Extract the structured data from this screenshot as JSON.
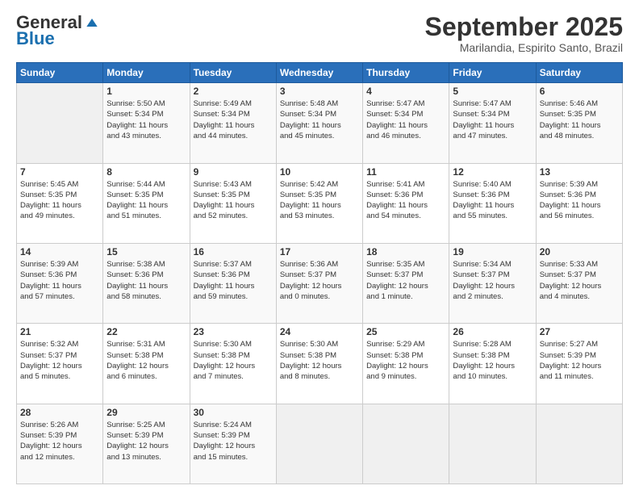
{
  "header": {
    "logo_general": "General",
    "logo_blue": "Blue",
    "month_title": "September 2025",
    "location": "Marilandia, Espirito Santo, Brazil"
  },
  "weekdays": [
    "Sunday",
    "Monday",
    "Tuesday",
    "Wednesday",
    "Thursday",
    "Friday",
    "Saturday"
  ],
  "weeks": [
    [
      {
        "day": "",
        "info": ""
      },
      {
        "day": "1",
        "info": "Sunrise: 5:50 AM\nSunset: 5:34 PM\nDaylight: 11 hours\nand 43 minutes."
      },
      {
        "day": "2",
        "info": "Sunrise: 5:49 AM\nSunset: 5:34 PM\nDaylight: 11 hours\nand 44 minutes."
      },
      {
        "day": "3",
        "info": "Sunrise: 5:48 AM\nSunset: 5:34 PM\nDaylight: 11 hours\nand 45 minutes."
      },
      {
        "day": "4",
        "info": "Sunrise: 5:47 AM\nSunset: 5:34 PM\nDaylight: 11 hours\nand 46 minutes."
      },
      {
        "day": "5",
        "info": "Sunrise: 5:47 AM\nSunset: 5:34 PM\nDaylight: 11 hours\nand 47 minutes."
      },
      {
        "day": "6",
        "info": "Sunrise: 5:46 AM\nSunset: 5:35 PM\nDaylight: 11 hours\nand 48 minutes."
      }
    ],
    [
      {
        "day": "7",
        "info": "Sunrise: 5:45 AM\nSunset: 5:35 PM\nDaylight: 11 hours\nand 49 minutes."
      },
      {
        "day": "8",
        "info": "Sunrise: 5:44 AM\nSunset: 5:35 PM\nDaylight: 11 hours\nand 51 minutes."
      },
      {
        "day": "9",
        "info": "Sunrise: 5:43 AM\nSunset: 5:35 PM\nDaylight: 11 hours\nand 52 minutes."
      },
      {
        "day": "10",
        "info": "Sunrise: 5:42 AM\nSunset: 5:35 PM\nDaylight: 11 hours\nand 53 minutes."
      },
      {
        "day": "11",
        "info": "Sunrise: 5:41 AM\nSunset: 5:36 PM\nDaylight: 11 hours\nand 54 minutes."
      },
      {
        "day": "12",
        "info": "Sunrise: 5:40 AM\nSunset: 5:36 PM\nDaylight: 11 hours\nand 55 minutes."
      },
      {
        "day": "13",
        "info": "Sunrise: 5:39 AM\nSunset: 5:36 PM\nDaylight: 11 hours\nand 56 minutes."
      }
    ],
    [
      {
        "day": "14",
        "info": "Sunrise: 5:39 AM\nSunset: 5:36 PM\nDaylight: 11 hours\nand 57 minutes."
      },
      {
        "day": "15",
        "info": "Sunrise: 5:38 AM\nSunset: 5:36 PM\nDaylight: 11 hours\nand 58 minutes."
      },
      {
        "day": "16",
        "info": "Sunrise: 5:37 AM\nSunset: 5:36 PM\nDaylight: 11 hours\nand 59 minutes."
      },
      {
        "day": "17",
        "info": "Sunrise: 5:36 AM\nSunset: 5:37 PM\nDaylight: 12 hours\nand 0 minutes."
      },
      {
        "day": "18",
        "info": "Sunrise: 5:35 AM\nSunset: 5:37 PM\nDaylight: 12 hours\nand 1 minute."
      },
      {
        "day": "19",
        "info": "Sunrise: 5:34 AM\nSunset: 5:37 PM\nDaylight: 12 hours\nand 2 minutes."
      },
      {
        "day": "20",
        "info": "Sunrise: 5:33 AM\nSunset: 5:37 PM\nDaylight: 12 hours\nand 4 minutes."
      }
    ],
    [
      {
        "day": "21",
        "info": "Sunrise: 5:32 AM\nSunset: 5:37 PM\nDaylight: 12 hours\nand 5 minutes."
      },
      {
        "day": "22",
        "info": "Sunrise: 5:31 AM\nSunset: 5:38 PM\nDaylight: 12 hours\nand 6 minutes."
      },
      {
        "day": "23",
        "info": "Sunrise: 5:30 AM\nSunset: 5:38 PM\nDaylight: 12 hours\nand 7 minutes."
      },
      {
        "day": "24",
        "info": "Sunrise: 5:30 AM\nSunset: 5:38 PM\nDaylight: 12 hours\nand 8 minutes."
      },
      {
        "day": "25",
        "info": "Sunrise: 5:29 AM\nSunset: 5:38 PM\nDaylight: 12 hours\nand 9 minutes."
      },
      {
        "day": "26",
        "info": "Sunrise: 5:28 AM\nSunset: 5:38 PM\nDaylight: 12 hours\nand 10 minutes."
      },
      {
        "day": "27",
        "info": "Sunrise: 5:27 AM\nSunset: 5:39 PM\nDaylight: 12 hours\nand 11 minutes."
      }
    ],
    [
      {
        "day": "28",
        "info": "Sunrise: 5:26 AM\nSunset: 5:39 PM\nDaylight: 12 hours\nand 12 minutes."
      },
      {
        "day": "29",
        "info": "Sunrise: 5:25 AM\nSunset: 5:39 PM\nDaylight: 12 hours\nand 13 minutes."
      },
      {
        "day": "30",
        "info": "Sunrise: 5:24 AM\nSunset: 5:39 PM\nDaylight: 12 hours\nand 15 minutes."
      },
      {
        "day": "",
        "info": ""
      },
      {
        "day": "",
        "info": ""
      },
      {
        "day": "",
        "info": ""
      },
      {
        "day": "",
        "info": ""
      }
    ]
  ]
}
